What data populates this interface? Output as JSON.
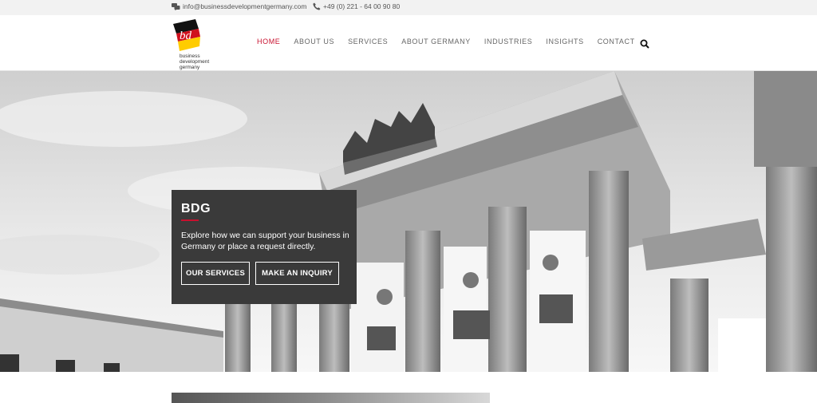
{
  "topbar": {
    "email": "info@businessdevelopmentgermany.com",
    "phone": "+49 (0) 221 - 64 00 90 80"
  },
  "logo": {
    "mark": "bd",
    "line1": "business",
    "line2": "development",
    "line3": "germany"
  },
  "nav": {
    "items": [
      "HOME",
      "ABOUT US",
      "SERVICES",
      "ABOUT GERMANY",
      "INDUSTRIES",
      "INSIGHTS",
      "CONTACT"
    ],
    "active_index": 0
  },
  "hero": {
    "title": "BDG",
    "text": "Explore how we can support your business in Germany or place a request directly.",
    "button1": "OUR SERVICES",
    "button2": "MAKE AN INQUIRY"
  },
  "colors": {
    "accent": "#c8102e",
    "panel": "#3a3a3a",
    "topbar": "#f2f2f2"
  }
}
